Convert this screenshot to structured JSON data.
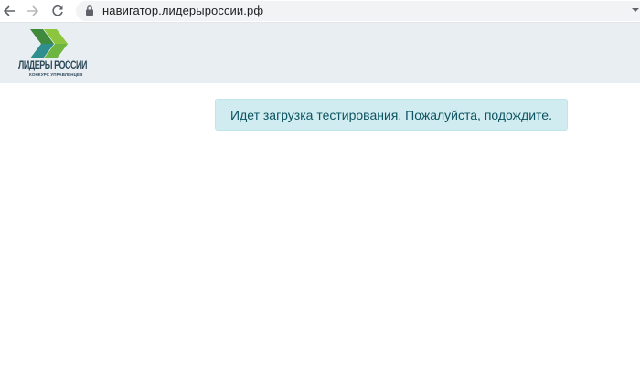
{
  "browser": {
    "url": "навигатор.лидерыроссии.рф",
    "icons": {
      "back": "arrow-left-icon",
      "forward": "arrow-right-icon",
      "reload": "reload-icon",
      "lock": "lock-icon",
      "menu": "chevron-down-icon"
    }
  },
  "header": {
    "logo_title": "ЛИДЕРЫ РОССИИ",
    "logo_subtitle": "КОНКУРС УПРАВЛЕНЦЕВ",
    "colors": {
      "logo_dark_green": "#3f8a3c",
      "logo_light_green": "#8cc63f",
      "logo_teal": "#2f8f8f",
      "header_bg": "#e9eef2"
    }
  },
  "main": {
    "loading_message": "Идет загрузка тестирования. Пожалуйста, подождите.",
    "colors": {
      "alert_bg": "#d1ecf1",
      "alert_border": "#bee5eb",
      "alert_text": "#0c5460"
    }
  }
}
